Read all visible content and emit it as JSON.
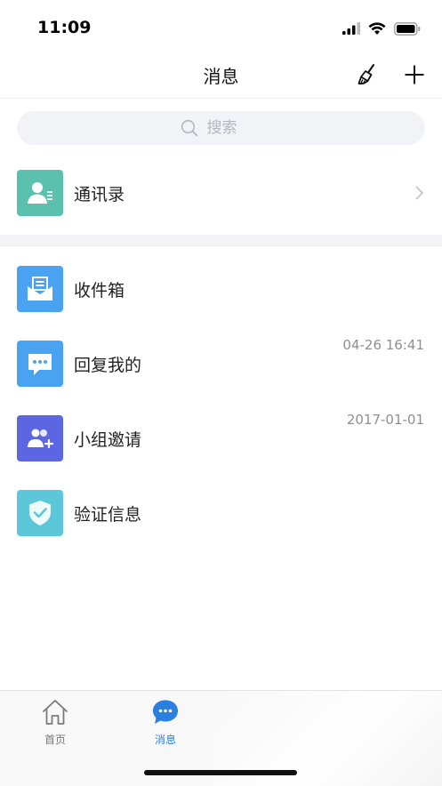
{
  "status": {
    "time": "11:09"
  },
  "nav": {
    "title": "消息"
  },
  "search": {
    "placeholder": "搜索"
  },
  "contacts": {
    "label": "通讯录"
  },
  "messages": [
    {
      "label": "收件箱",
      "time": "",
      "icon": "inbox-icon",
      "color": "#4aa3f0"
    },
    {
      "label": "回复我的",
      "time": "04-26 16:41",
      "icon": "reply-bubble-icon",
      "color": "#4aa3f0"
    },
    {
      "label": "小组邀请",
      "time": "2017-01-01",
      "icon": "group-invite-icon",
      "color": "#5b67e0"
    },
    {
      "label": "验证信息",
      "time": "",
      "icon": "shield-check-icon",
      "color": "#5cc7d8"
    }
  ],
  "tabs": [
    {
      "label": "首页",
      "active": false
    },
    {
      "label": "消息",
      "active": true
    }
  ],
  "colors": {
    "accent": "#2b7fe0",
    "contacts": "#5bc0ae"
  }
}
